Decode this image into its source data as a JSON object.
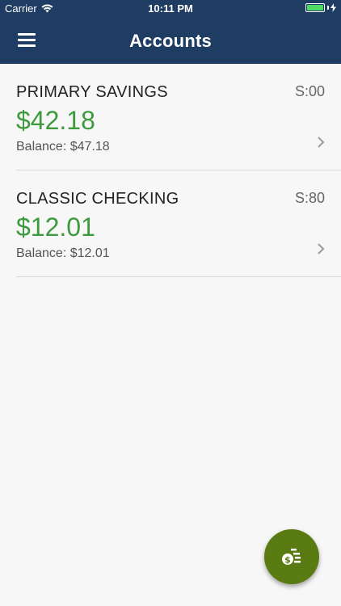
{
  "status_bar": {
    "carrier": "Carrier",
    "time": "10:11 PM",
    "battery_level": 1.0
  },
  "header": {
    "title": "Accounts",
    "menu_icon": "hamburger-menu-icon"
  },
  "accounts": [
    {
      "name": "PRIMARY SAVINGS",
      "code": "S:00",
      "amount": "$42.18",
      "balance": "Balance: $47.18"
    },
    {
      "name": "CLASSIC CHECKING",
      "code": "S:80",
      "amount": "$12.01",
      "balance": "Balance: $12.01"
    }
  ],
  "fab": {
    "icon": "money-transfer-icon"
  },
  "colors": {
    "header_bg": "#1f3d63",
    "amount_green": "#3e9a3e",
    "fab_bg": "#5a7a12",
    "battery_green": "#4cd964"
  }
}
